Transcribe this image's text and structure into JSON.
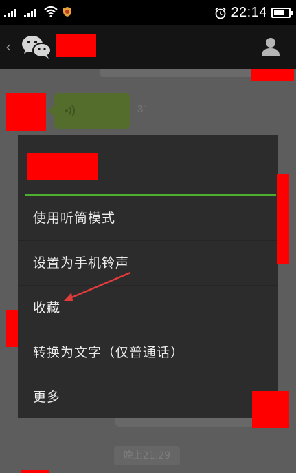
{
  "status_bar": {
    "time": "22:14",
    "battery_level": 0.75,
    "icons": [
      "signal-icon",
      "signal-icon",
      "wifi-icon",
      "shield-icon",
      "alarm-icon",
      "battery-icon"
    ]
  },
  "title_bar": {
    "back_glyph": "‹",
    "icons": [
      "back-icon",
      "wechat-icon",
      "contact-icon"
    ]
  },
  "chat": {
    "voice_duration": "3\"",
    "timestamp": "晚上21:29"
  },
  "context_menu": {
    "items": [
      {
        "label": "使用听筒模式"
      },
      {
        "label": "设置为手机铃声"
      },
      {
        "label": "收藏"
      },
      {
        "label": "转换为文字（仅普通话）"
      },
      {
        "label": "更多"
      }
    ]
  },
  "colors": {
    "accent_divider": "#4cae2c",
    "menu_background": "#2c2c2c",
    "annotation_arrow": "#e23b3b",
    "redaction": "#ff0000"
  }
}
